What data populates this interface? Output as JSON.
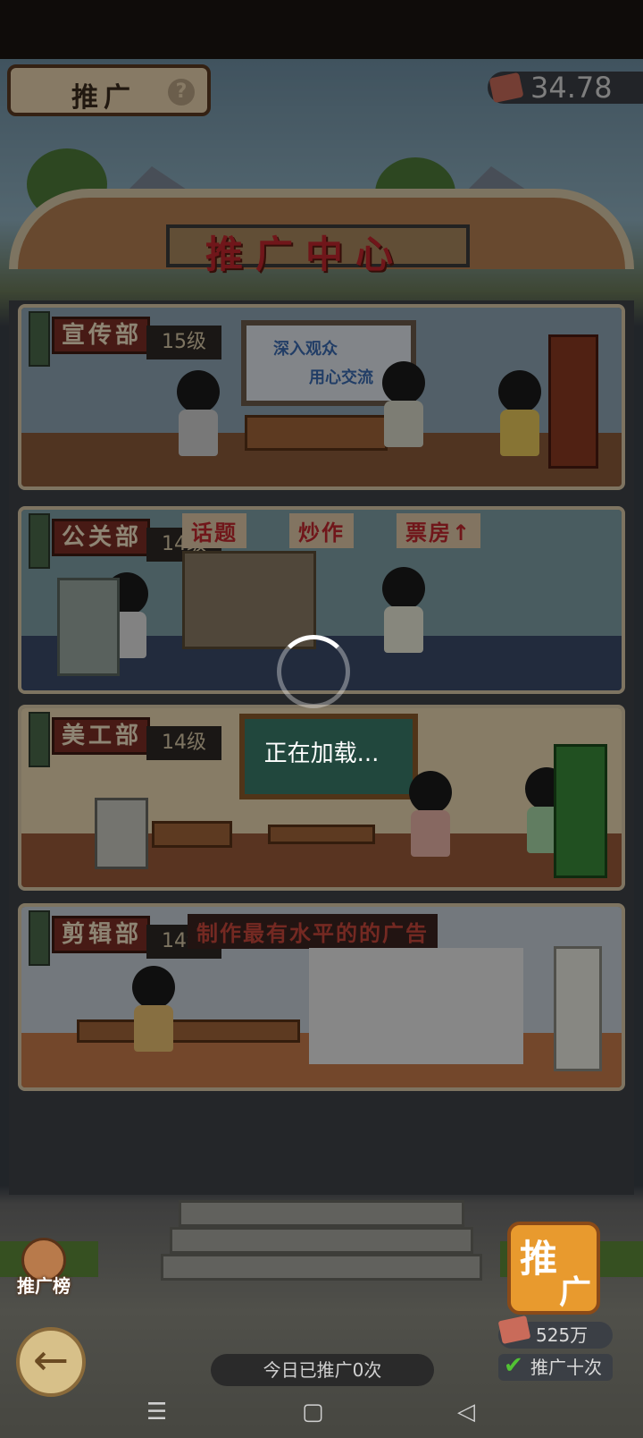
{
  "header": {
    "title": "推广",
    "help": "?",
    "cash_value": "34.78"
  },
  "center_sign": "推广中心",
  "departments": [
    {
      "name": "宣传部",
      "level": "15级",
      "board_line1": "深入观众",
      "board_line2": "用心交流"
    },
    {
      "name": "公关部",
      "level": "14级",
      "banners": [
        "话题",
        "炒作",
        "票房↑"
      ]
    },
    {
      "name": "美工部",
      "level": "14级"
    },
    {
      "name": "剪辑部",
      "level": "14级",
      "banner": "制作最有水平的的广告"
    }
  ],
  "loading_text": "正在加载...",
  "bottom": {
    "rank_label": "推广榜",
    "back_icon": "←",
    "promote_button_char1": "推",
    "promote_button_char2": "广",
    "cost": "525万",
    "promote_ten": "推广十次",
    "today_count": "今日已推广0次"
  },
  "navbar": {
    "menu_icon": "☰",
    "home_icon": "▢",
    "back_icon": "◁"
  },
  "colors": {
    "overlay": "rgba(0,0,0,0.42)",
    "accent": "#e89a2e",
    "sign_text": "#c1272d"
  }
}
